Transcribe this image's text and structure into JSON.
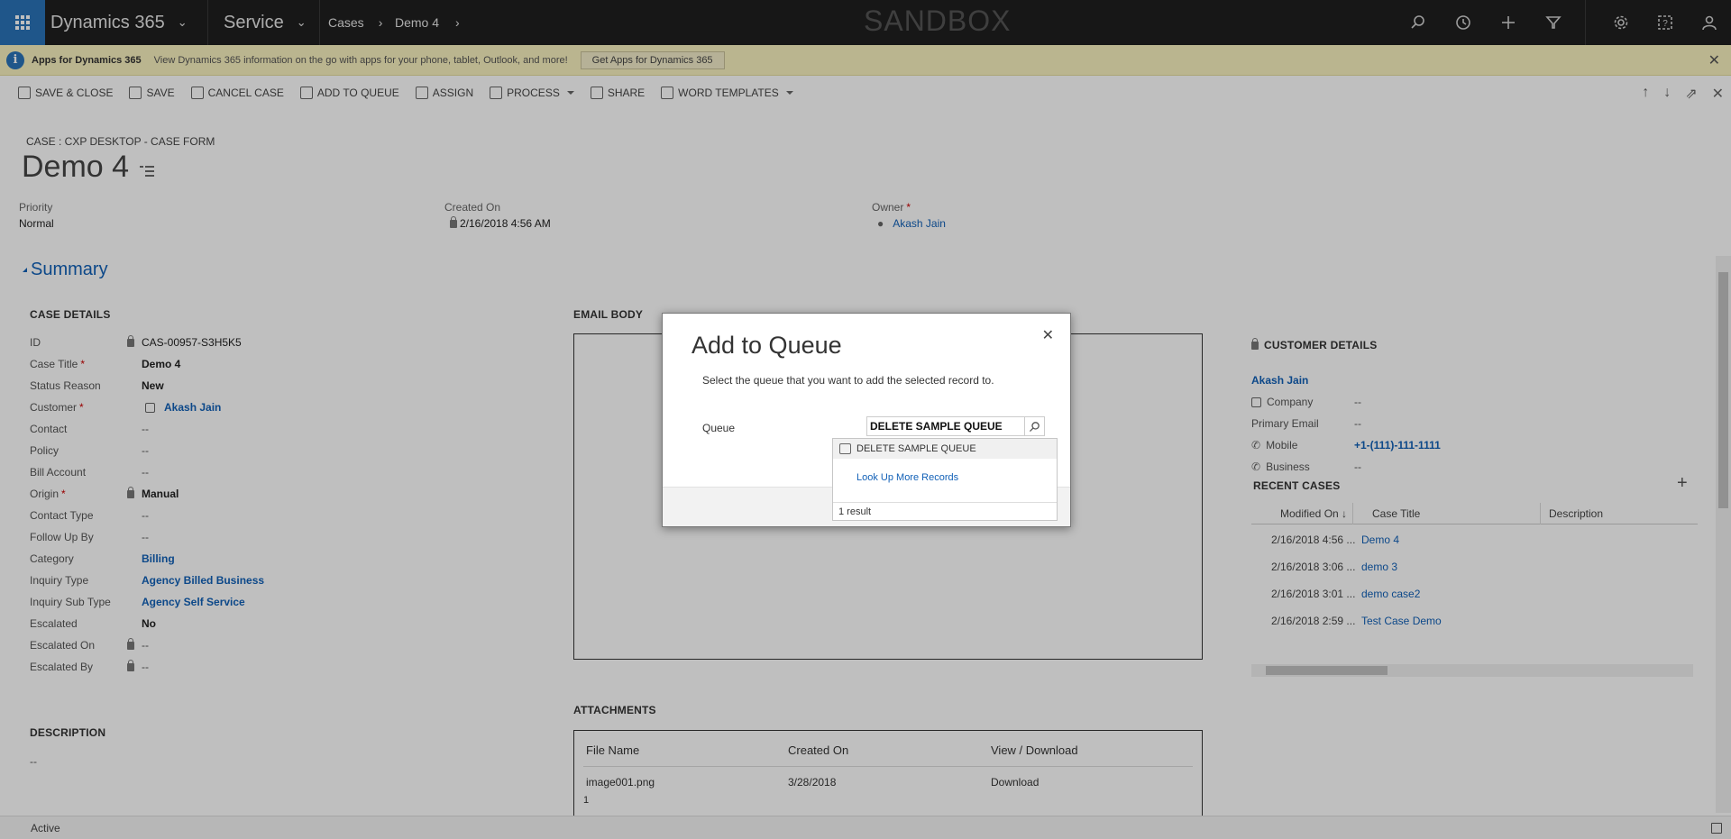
{
  "topbar": {
    "app_name": "Dynamics 365",
    "module": "Service",
    "breadcrumb": [
      "Cases",
      "Demo 4"
    ],
    "environment_label": "SANDBOX",
    "accent_color": "#2a73b9"
  },
  "notification": {
    "title": "Apps for Dynamics 365",
    "message": "View Dynamics 365 information on the go with apps for your phone, tablet, Outlook, and more!",
    "button": "Get Apps for Dynamics 365"
  },
  "commands": [
    "SAVE & CLOSE",
    "SAVE",
    "CANCEL CASE",
    "ADD TO QUEUE",
    "ASSIGN",
    "PROCESS",
    "SHARE",
    "WORD TEMPLATES"
  ],
  "form": {
    "crumb": "CASE : CXP DESKTOP - CASE FORM",
    "title": "Demo 4",
    "header": {
      "priority_label": "Priority",
      "priority": "Normal",
      "created_label": "Created On",
      "created": "2/16/2018   4:56 AM",
      "owner_label": "Owner",
      "owner": "Akash Jain"
    },
    "summary_label": "Summary",
    "case_details_title": "CASE DETAILS",
    "case_details": [
      {
        "label": "ID",
        "value": "CAS-00957-S3H5K5"
      },
      {
        "label": "Case Title",
        "value": "Demo 4"
      },
      {
        "label": "Status Reason",
        "value": "New"
      },
      {
        "label": "Customer",
        "value": "Akash Jain"
      },
      {
        "label": "Contact",
        "value": "--"
      },
      {
        "label": "Policy",
        "value": "--"
      },
      {
        "label": "Bill Account",
        "value": "--"
      },
      {
        "label": "Origin",
        "value": "Manual"
      },
      {
        "label": "Contact Type",
        "value": "--"
      },
      {
        "label": "Follow Up By",
        "value": "--"
      },
      {
        "label": "Category",
        "value": "Billing"
      },
      {
        "label": "Inquiry Type",
        "value": "Agency Billed Business"
      },
      {
        "label": "Inquiry Sub Type",
        "value": "Agency Self Service"
      },
      {
        "label": "Escalated",
        "value": "No"
      },
      {
        "label": "Escalated On",
        "value": "--"
      },
      {
        "label": "Escalated By",
        "value": "--"
      }
    ],
    "description_title": "DESCRIPTION",
    "description_value": "--",
    "email_body_title": "EMAIL BODY",
    "attachments": {
      "title": "ATTACHMENTS",
      "columns": [
        "File Name",
        "Created On",
        "View / Download"
      ],
      "row": {
        "file": "image001.png",
        "created": "3/28/2018",
        "link": "Download"
      },
      "page": "1"
    },
    "customer": {
      "title": "CUSTOMER DETAILS",
      "name": "Akash Jain",
      "company_label": "Company",
      "company": "--",
      "email_label": "Primary Email",
      "email": "--",
      "mobile_label": "Mobile",
      "mobile": "+1-(111)-111-1111",
      "business_label": "Business",
      "business": "--"
    },
    "recent_cases": {
      "title": "RECENT CASES",
      "columns": [
        "Modified On",
        "Case Title",
        "Description"
      ],
      "rows": [
        {
          "date": "2/16/2018 4:56 ...",
          "title": "Demo 4"
        },
        {
          "date": "2/16/2018 3:06 ...",
          "title": "demo 3"
        },
        {
          "date": "2/16/2018 3:01 ...",
          "title": "demo case2"
        },
        {
          "date": "2/16/2018 2:59 ...",
          "title": "Test Case Demo"
        }
      ]
    }
  },
  "status": "Active",
  "dialog": {
    "title": "Add to Queue",
    "description": "Select the queue that you want to add the selected record to.",
    "queue_label": "Queue",
    "queue_value": "DELETE SAMPLE QUEUE",
    "result_item": "DELETE SAMPLE QUEUE",
    "lookup_more": "Look Up More Records",
    "result_count": "1 result"
  }
}
